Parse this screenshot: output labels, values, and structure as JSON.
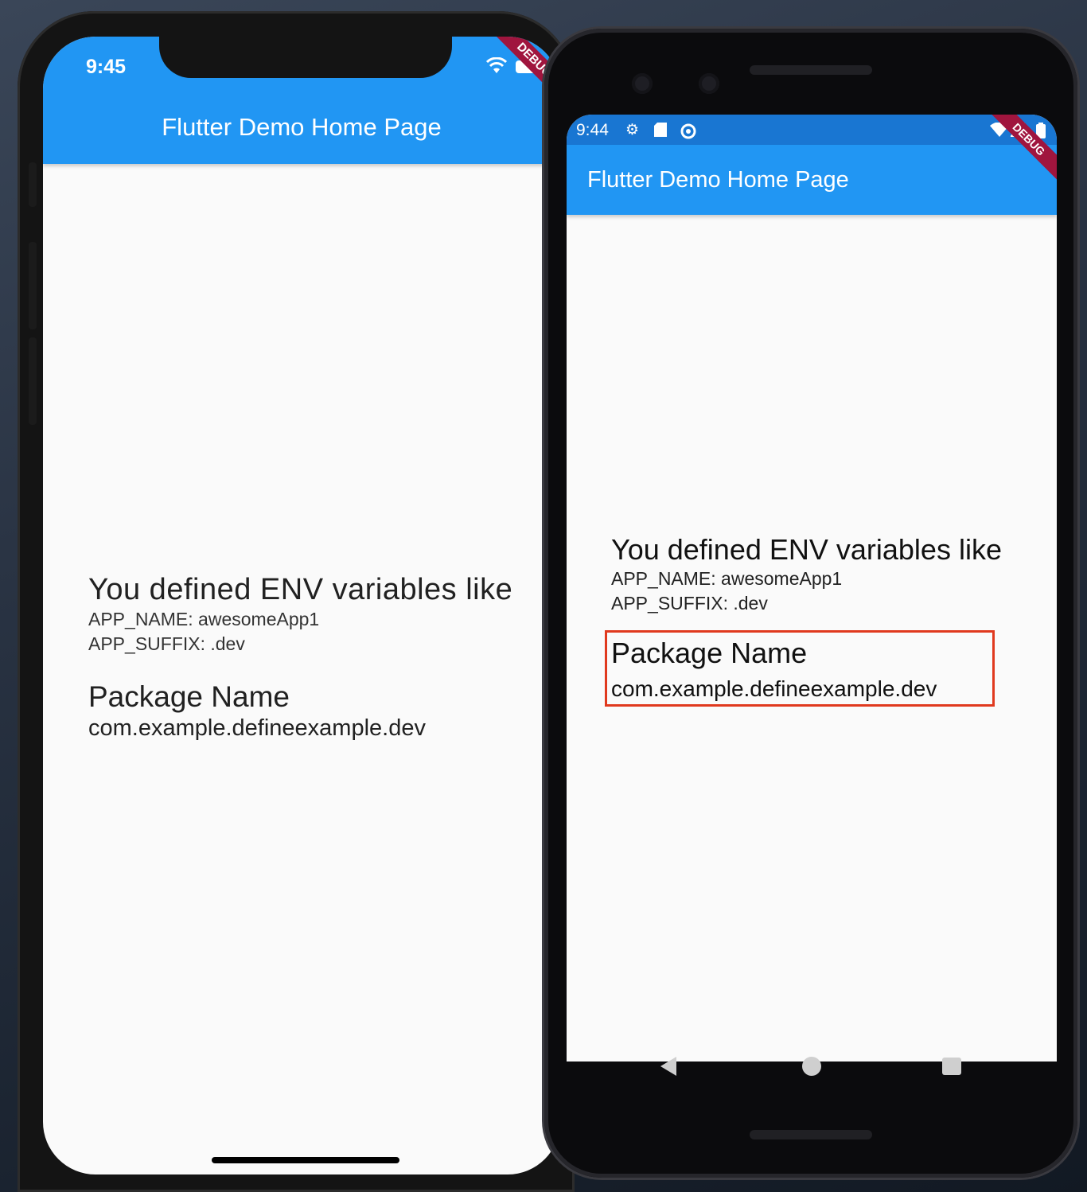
{
  "ios": {
    "status_time": "9:45",
    "appbar_title": "Flutter Demo Home Page",
    "debug_banner": "DEBUG",
    "headline": "You defined ENV variables like",
    "env_lines": [
      "APP_NAME: awesomeApp1",
      "APP_SUFFIX: .dev"
    ],
    "package_title": "Package Name",
    "package_value": "com.example.defineexample.dev"
  },
  "android": {
    "status_time": "9:44",
    "status_icons": [
      "settings-icon",
      "sd-card-icon",
      "sync-icon",
      "wifi-icon",
      "signal-icon",
      "battery-icon"
    ],
    "appbar_title": "Flutter Demo Home Page",
    "debug_banner": "DEBUG",
    "headline": "You defined ENV variables like",
    "env_lines": [
      "APP_NAME: awesomeApp1",
      "APP_SUFFIX: .dev"
    ],
    "package_title": "Package Name",
    "package_value": "com.example.defineexample.dev",
    "nav": [
      "back-icon",
      "home-icon",
      "recents-icon"
    ]
  },
  "colors": {
    "appbar": "#2196f3",
    "android_statusbar": "#1976d2",
    "debug_ribbon": "#a0153e",
    "highlight_box": "#e0391e"
  }
}
